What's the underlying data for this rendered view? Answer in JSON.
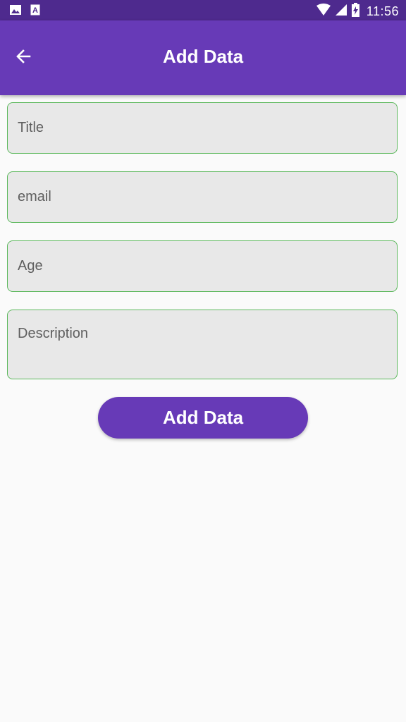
{
  "status_bar": {
    "time": "11:56",
    "icons": [
      "image-icon",
      "text-a-icon",
      "wifi-icon",
      "signal-icon",
      "battery-charging-icon"
    ]
  },
  "app_bar": {
    "title": "Add Data",
    "back_icon": "arrow-back-icon",
    "background": "#673ab7"
  },
  "form": {
    "title_field": {
      "placeholder": "Title",
      "value": ""
    },
    "email_field": {
      "placeholder": "email",
      "value": ""
    },
    "age_field": {
      "placeholder": "Age",
      "value": ""
    },
    "description_field": {
      "placeholder": "Description",
      "value": ""
    },
    "submit_label": "Add Data"
  },
  "colors": {
    "accent": "#673ab7",
    "status_bar": "#4e2a8e",
    "field_border": "#5cb85c",
    "field_background": "#e8e8e8"
  }
}
